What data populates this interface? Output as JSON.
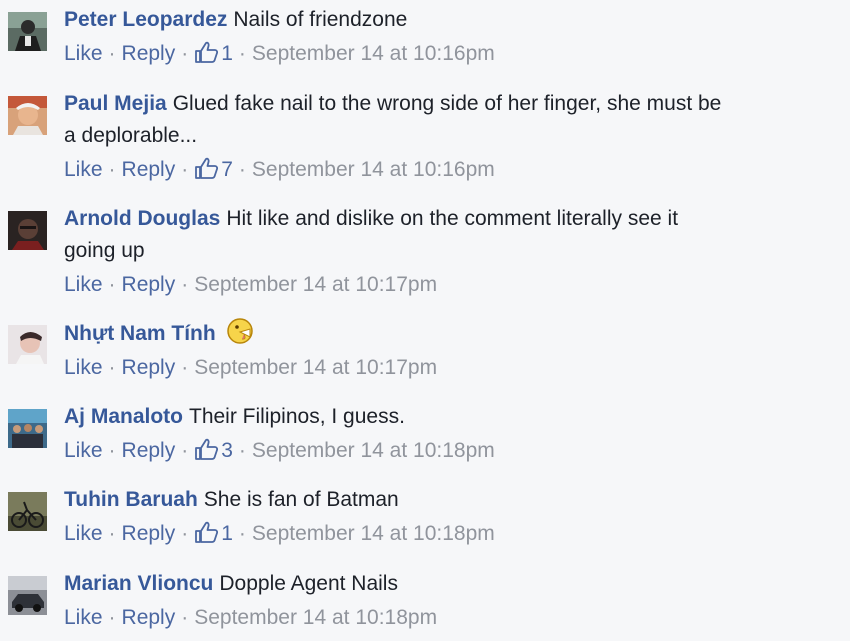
{
  "comments": [
    {
      "author": "Peter Leopardez",
      "text": "Nails of friendzone",
      "like_label": "Like",
      "reply_label": "Reply",
      "reaction_count": "1",
      "time": "September 14 at 10:16pm",
      "avatar": "avatar-man-dark-clothes"
    },
    {
      "author": "Paul Mejia",
      "text": "Glued fake nail to the wrong side of her finger, she must be",
      "text2": "a deplorable...",
      "like_label": "Like",
      "reply_label": "Reply",
      "reaction_count": "7",
      "time": "September 14 at 10:16pm",
      "avatar": "avatar-older-man"
    },
    {
      "author": "Arnold Douglas",
      "text": "Hit like and dislike on the comment literally see it",
      "text2": "going up",
      "like_label": "Like",
      "reply_label": "Reply",
      "time": "September 14 at 10:17pm",
      "avatar": "avatar-man-dark"
    },
    {
      "author": "Nhựt Nam Tính",
      "text": "",
      "emoji": "tongue-face-emoji",
      "like_label": "Like",
      "reply_label": "Reply",
      "time": "September 14 at 10:17pm",
      "avatar": "avatar-young-man"
    },
    {
      "author": "Aj Manaloto",
      "text": "Their Filipinos, I guess.",
      "like_label": "Like",
      "reply_label": "Reply",
      "reaction_count": "3",
      "time": "September 14 at 10:18pm",
      "avatar": "avatar-group-photo"
    },
    {
      "author": "Tuhin Baruah",
      "text": "She is fan of Batman",
      "like_label": "Like",
      "reply_label": "Reply",
      "reaction_count": "1",
      "time": "September 14 at 10:18pm",
      "avatar": "avatar-bike"
    },
    {
      "author": "Marian Vlioncu",
      "text": "Dopple Agent Nails",
      "like_label": "Like",
      "reply_label": "Reply",
      "time": "September 14 at 10:18pm",
      "avatar": "avatar-car"
    }
  ],
  "colors": {
    "author": "#365899",
    "link": "#4b67a1",
    "meta": "#90949c",
    "background": "#f6f7f9"
  }
}
